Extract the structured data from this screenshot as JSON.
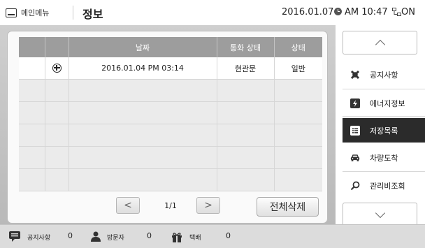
{
  "header": {
    "menu_label": "메인메뉴",
    "title": "정보",
    "date": "2016.01.07",
    "time": "AM 10:47",
    "network": "ON"
  },
  "table": {
    "columns": [
      "",
      "",
      "날짜",
      "통화 상태",
      "상태"
    ],
    "rows": [
      {
        "icon": "phone-icon",
        "date": "2016.01.04 PM 03:14",
        "call_status": "현관문",
        "status": "일반"
      }
    ]
  },
  "pager": {
    "page": "1/1",
    "prev": "<",
    "next": ">"
  },
  "delete_all_label": "전체삭제",
  "sidebar": {
    "items": [
      {
        "label": "공지사항",
        "icon": "notice-icon"
      },
      {
        "label": "에너지정보",
        "icon": "energy-icon"
      },
      {
        "label": "저장목록",
        "icon": "list-icon",
        "active": true
      },
      {
        "label": "차량도착",
        "icon": "car-icon"
      },
      {
        "label": "관리비조회",
        "icon": "search-icon"
      }
    ]
  },
  "footer": {
    "notice_label": "공지사항",
    "notice_count": "0",
    "visitor_label": "방문자",
    "visitor_count": "0",
    "delivery_label": "택배",
    "delivery_count": "0"
  }
}
